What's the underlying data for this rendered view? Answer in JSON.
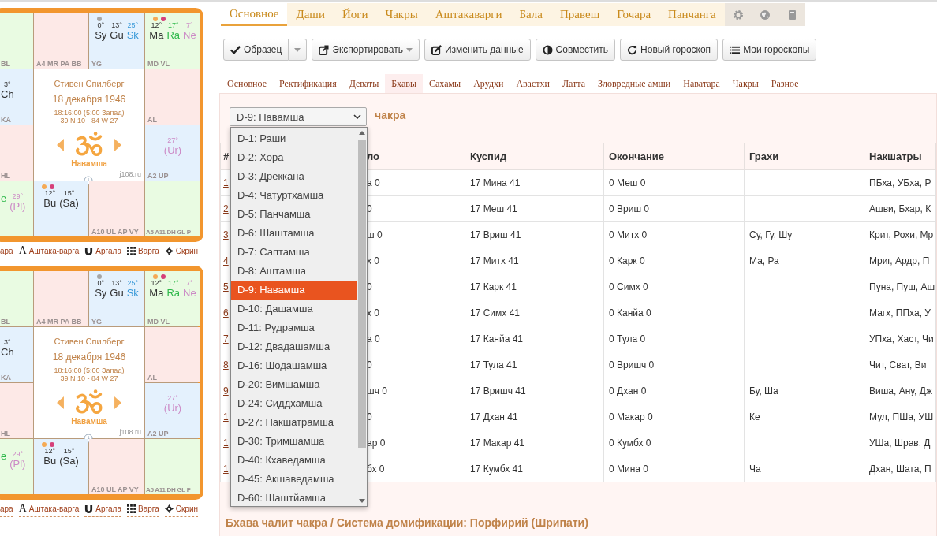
{
  "sidebar": {
    "charts": [
      {
        "cells": [
          {
            "color": "#e9fbe2",
            "label": "BL"
          },
          {
            "color": "#fde9e7",
            "label": "A4 MR PA BB"
          },
          {
            "color": "#e4f1fd",
            "label": "YG",
            "dots": [
              {
                "color": "#a6a6a6"
              }
            ],
            "planets": [
              {
                "deg": "0°",
                "name": "Sy",
                "color": "#333333"
              },
              {
                "deg": "13°",
                "name": "Gu",
                "color": "#333333"
              },
              {
                "deg": "25°",
                "name": "Sk",
                "color": "#3a9ad9"
              }
            ]
          },
          {
            "color": "#e9fbe2",
            "label": "MD VL",
            "dots": [
              {
                "color": "#f5aa55"
              },
              {
                "color": "#d6407a"
              }
            ],
            "planets": [
              {
                "deg": "12°",
                "name": "Ma",
                "color": "#333333"
              },
              {
                "deg": "17°",
                "name": "Ra",
                "color": "#2db84a"
              },
              {
                "deg": "7°",
                "name": "Ne",
                "color": "#cc8ac6"
              }
            ]
          },
          {
            "color": "#e4f1fd",
            "label": "KA",
            "planets": [
              {
                "deg": "3°",
                "name": "Ch",
                "color": "#333333"
              }
            ]
          },
          {
            "color": "#fde9e7",
            "label": "AL"
          },
          {
            "color": "#fde9e7",
            "label": "HL"
          },
          {
            "color": "#e4f1fd",
            "label": "A2 UP",
            "planets": [
              {
                "deg": "27°",
                "name": "(Ur)",
                "color": "#cc8ac6"
              }
            ]
          },
          {
            "color": "#e9fbe2",
            "planets": [
              {
                "name": "e",
                "color": "#2db84a"
              },
              {
                "deg": "29°",
                "name": "(Pl)",
                "color": "#cc8ac6"
              }
            ]
          },
          {
            "color": "#e4f1fd",
            "dots": [
              {
                "color": "#f5aa55"
              },
              {
                "color": "#d6407a"
              }
            ],
            "planets": [
              {
                "deg": "12°",
                "name": "Bu",
                "color": "#333333"
              },
              {
                "deg": "15°",
                "name": "(Sa)",
                "color": "#333333"
              }
            ]
          },
          {
            "color": "#fde9e7",
            "label": "A10 UL AP VY"
          },
          {
            "color": "#e9fbe2",
            "label": "A5 A11 DH GL P"
          }
        ],
        "center": {
          "name": "Стивен Спилберг",
          "date": "18 декабря 1946",
          "time": "18:16:00 (5:00 Запад)",
          "coords": "39 N 10 - 84 W 27",
          "varga": "Навамша",
          "site": "j108.ru"
        },
        "links": [
          {
            "label": "ара"
          },
          {
            "label": "Аштака-варга",
            "kind": "glyph",
            "glyph": "A"
          },
          {
            "label": "Аргала",
            "kind": "magnet"
          },
          {
            "label": "Варга",
            "kind": "grid"
          },
          {
            "label": "Скрин",
            "kind": "crosshair"
          }
        ]
      },
      {
        "cells": [
          {
            "color": "#e9fbe2",
            "label": "BL"
          },
          {
            "color": "#fde9e7",
            "label": "A4 MR PA BB"
          },
          {
            "color": "#e4f1fd",
            "label": "YG",
            "dots": [
              {
                "color": "#a6a6a6"
              }
            ],
            "planets": [
              {
                "deg": "0°",
                "name": "Sy",
                "color": "#333333"
              },
              {
                "deg": "13°",
                "name": "Gu",
                "color": "#333333"
              },
              {
                "deg": "25°",
                "name": "Sk",
                "color": "#3a9ad9"
              }
            ]
          },
          {
            "color": "#e9fbe2",
            "label": "MD VL",
            "dots": [
              {
                "color": "#f5aa55"
              },
              {
                "color": "#d6407a"
              }
            ],
            "planets": [
              {
                "deg": "12°",
                "name": "Ma",
                "color": "#333333"
              },
              {
                "deg": "17°",
                "name": "Ra",
                "color": "#2db84a"
              },
              {
                "deg": "7°",
                "name": "Ne",
                "color": "#cc8ac6"
              }
            ]
          },
          {
            "color": "#e4f1fd",
            "label": "KA",
            "planets": [
              {
                "deg": "3°",
                "name": "Ch",
                "color": "#333333"
              }
            ]
          },
          {
            "color": "#fde9e7",
            "label": "AL"
          },
          {
            "color": "#fde9e7",
            "label": "HL"
          },
          {
            "color": "#e4f1fd",
            "label": "A2 UP",
            "planets": [
              {
                "deg": "27°",
                "name": "(Ur)",
                "color": "#cc8ac6"
              }
            ]
          },
          {
            "color": "#e9fbe2",
            "planets": [
              {
                "name": "e",
                "color": "#2db84a"
              },
              {
                "deg": "29°",
                "name": "(Pl)",
                "color": "#cc8ac6"
              }
            ]
          },
          {
            "color": "#e4f1fd",
            "dots": [
              {
                "color": "#f5aa55"
              },
              {
                "color": "#d6407a"
              }
            ],
            "planets": [
              {
                "deg": "12°",
                "name": "Bu",
                "color": "#333333"
              },
              {
                "deg": "15°",
                "name": "(Sa)",
                "color": "#333333"
              }
            ]
          },
          {
            "color": "#fde9e7",
            "label": "A10 UL AP VY"
          },
          {
            "color": "#e9fbe2",
            "label": "A5 A11 DH GL P"
          }
        ],
        "center": {
          "name": "Стивен Спилберг",
          "date": "18 декабря 1946",
          "time": "18:16:00 (5:00 Запад)",
          "coords": "39 N 10 - 84 W 27",
          "varga": "Навамша",
          "site": "j108.ru"
        },
        "links": [
          {
            "label": "ара"
          },
          {
            "label": "Аштака-варга",
            "kind": "glyph",
            "glyph": "A"
          },
          {
            "label": "Аргала",
            "kind": "magnet"
          },
          {
            "label": "Варга",
            "kind": "grid"
          },
          {
            "label": "Скрин",
            "kind": "crosshair"
          }
        ]
      }
    ]
  },
  "main_tabs": [
    {
      "label": "Основное",
      "selected": true
    },
    {
      "label": "Даши",
      "selected": false
    },
    {
      "label": "Йоги",
      "selected": false
    },
    {
      "label": "Чакры",
      "selected": false
    },
    {
      "label": "Аштакаварги",
      "selected": false
    },
    {
      "label": "Бала",
      "selected": false
    },
    {
      "label": "Правеш",
      "selected": false
    },
    {
      "label": "Гочара",
      "selected": false
    },
    {
      "label": "Панчанга",
      "selected": false
    },
    {
      "kind": "gear",
      "selected": false
    },
    {
      "kind": "globe",
      "selected": false
    },
    {
      "kind": "book",
      "selected": false
    }
  ],
  "toolbar": [
    {
      "label": "Образец",
      "kind": "check",
      "split": true
    },
    {
      "label": "Экспортировать",
      "kind": "export",
      "caret": true
    },
    {
      "label": "Изменить данные",
      "kind": "edit"
    },
    {
      "label": "Совместить",
      "kind": "contrast"
    },
    {
      "label": "Новый гороскоп",
      "kind": "refresh"
    },
    {
      "label": "Мои гороскопы",
      "kind": "list"
    }
  ],
  "sub_tabs": [
    {
      "label": "Основное",
      "selected": false
    },
    {
      "label": "Ректификация",
      "selected": false
    },
    {
      "label": "Деваты",
      "selected": false
    },
    {
      "label": "Бхавы",
      "selected": true
    },
    {
      "label": "Сахамы",
      "selected": false
    },
    {
      "label": "Арудхи",
      "selected": false
    },
    {
      "label": "Авастхи",
      "selected": false
    },
    {
      "label": "Латта",
      "selected": false
    },
    {
      "label": "Зловредные амши",
      "selected": false
    },
    {
      "label": "Наватара",
      "selected": false
    },
    {
      "label": "Чакры",
      "selected": false
    },
    {
      "label": "Разное",
      "selected": false
    }
  ],
  "chart_select": {
    "value": "D-9: Навамша",
    "options": [
      {
        "label": "D-1: Раши",
        "selected": false
      },
      {
        "label": "D-2: Хора",
        "selected": false
      },
      {
        "label": "D-3: Дреккана",
        "selected": false
      },
      {
        "label": "D-4: Чатуртхамша",
        "selected": false
      },
      {
        "label": "D-5: Панчамша",
        "selected": false
      },
      {
        "label": "D-6: Шаштамша",
        "selected": false
      },
      {
        "label": "D-7: Саптамша",
        "selected": false
      },
      {
        "label": "D-8: Аштамша",
        "selected": false
      },
      {
        "label": "D-9: Навамша",
        "selected": true
      },
      {
        "label": "D-10: Дашамша",
        "selected": false
      },
      {
        "label": "D-11: Рудрамша",
        "selected": false
      },
      {
        "label": "D-12: Двадашамша",
        "selected": false
      },
      {
        "label": "D-16: Шодашамша",
        "selected": false
      },
      {
        "label": "D-20: Вимшамша",
        "selected": false
      },
      {
        "label": "D-24: Сиддхамша",
        "selected": false
      },
      {
        "label": "D-27: Накшатрамша",
        "selected": false
      },
      {
        "label": "D-30: Тримшамша",
        "selected": false
      },
      {
        "label": "D-40: Кхаведамша",
        "selected": false
      },
      {
        "label": "D-45: Акшаведамша",
        "selected": false
      },
      {
        "label": "D-60: Шаштйамша",
        "selected": false
      }
    ]
  },
  "section_title": "чакра",
  "table": {
    "columns": [
      "#",
      "ло",
      "Куспид",
      "Окончание",
      "Грахи",
      "Накшатры"
    ],
    "rows": [
      {
        "num": "1",
        "start": "а 0",
        "cusp": "17 Мина 41",
        "end": "0 Меш 0",
        "nakshatras": "ПБха, УБха, Р"
      },
      {
        "num": "2",
        "start": "0",
        "cusp": "17 Меш 41",
        "end": "0 Вриш 0",
        "nakshatras": "Ашви, Бхар, К"
      },
      {
        "num": "3",
        "start": "ш 0",
        "cusp": "17 Вриш 41",
        "end": "0 Митх 0",
        "grahi": "Су, Гу, Шу",
        "nakshatras": "Крит, Рохи, Мр"
      },
      {
        "num": "4",
        "start": "х 0",
        "cusp": "17 Митх 41",
        "end": "0 Карк 0",
        "grahi": "Ма, Ра",
        "nakshatras": "Мриг, Ардр, П"
      },
      {
        "num": "5",
        "start": "0",
        "cusp": "17 Карк 41",
        "end": "0 Симх 0",
        "nakshatras": "Пуна, Пуш, Аш"
      },
      {
        "num": "6",
        "start": "х 0",
        "cusp": "17 Симх 41",
        "end": "0 Канйа 0",
        "nakshatras": "Магх, ППха, У"
      },
      {
        "num": "7",
        "start": "а 0",
        "cusp": "17 Канйа 41",
        "end": "0 Тула 0",
        "nakshatras": "УПха, Хаст, Чи"
      },
      {
        "num": "8",
        "start": "0",
        "cusp": "17 Тула 41",
        "end": "0 Вришч 0",
        "nakshatras": "Чит, Сват, Ви"
      },
      {
        "num": "9",
        "start": "шч 0",
        "cusp": "17 Вришч 41",
        "end": "0 Дхан 0",
        "grahi": "Бу, Ша",
        "nakshatras": "Виша, Ану, Дж"
      },
      {
        "num": "1",
        "start": "0",
        "cusp": "17 Дхан 41",
        "end": "0 Макар 0",
        "grahi": "Ке",
        "nakshatras": "Мул, ПШа, УШ"
      },
      {
        "num": "1",
        "start": "ар 0",
        "cusp": "17 Макар 41",
        "end": "0 Кумбх 0",
        "nakshatras": "УШа, Шрав, Д"
      },
      {
        "num": "1",
        "start": "бх 0",
        "cusp": "17 Кумбх 41",
        "end": "0 Мина 0",
        "grahi": "Ча",
        "nakshatras": "Дхан, Шата, П"
      }
    ]
  },
  "footer_title": "Бхава чалит чакра / Система домификации: Порфирий (Шрипати)"
}
